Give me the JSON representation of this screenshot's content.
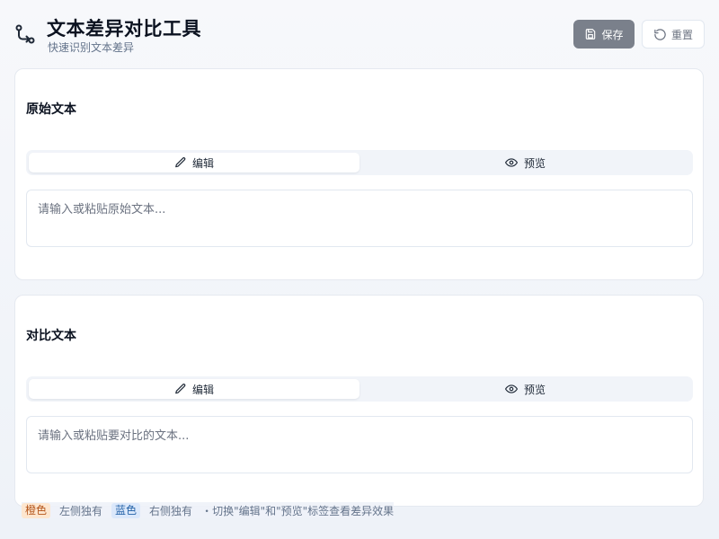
{
  "header": {
    "title": "文本差异对比工具",
    "subtitle": "快速识别文本差异",
    "logo_icon": "git-compare-icon",
    "save_label": "保存",
    "reset_label": "重置"
  },
  "panels": [
    {
      "title": "原始文本",
      "tabs": [
        {
          "label": "编辑",
          "icon": "pencil-icon",
          "active": true
        },
        {
          "label": "预览",
          "icon": "eye-icon",
          "active": false
        }
      ],
      "placeholder": "请输入或粘贴原始文本...",
      "value": ""
    },
    {
      "title": "对比文本",
      "tabs": [
        {
          "label": "编辑",
          "icon": "pencil-icon",
          "active": true
        },
        {
          "label": "预览",
          "icon": "eye-icon",
          "active": false
        }
      ],
      "placeholder": "请输入或粘贴要对比的文本...",
      "value": ""
    }
  ],
  "legend": {
    "left_chip": "橙色",
    "left_text": "左侧独有",
    "right_chip": "蓝色",
    "right_text": "右侧独有",
    "tip": "・切换\"编辑\"和\"预览\"标签查看差异效果"
  },
  "colors": {
    "save_button_bg": "#7a808b",
    "orange_chip_bg": "#fde6cf",
    "blue_chip_bg": "#dbe8fb"
  }
}
